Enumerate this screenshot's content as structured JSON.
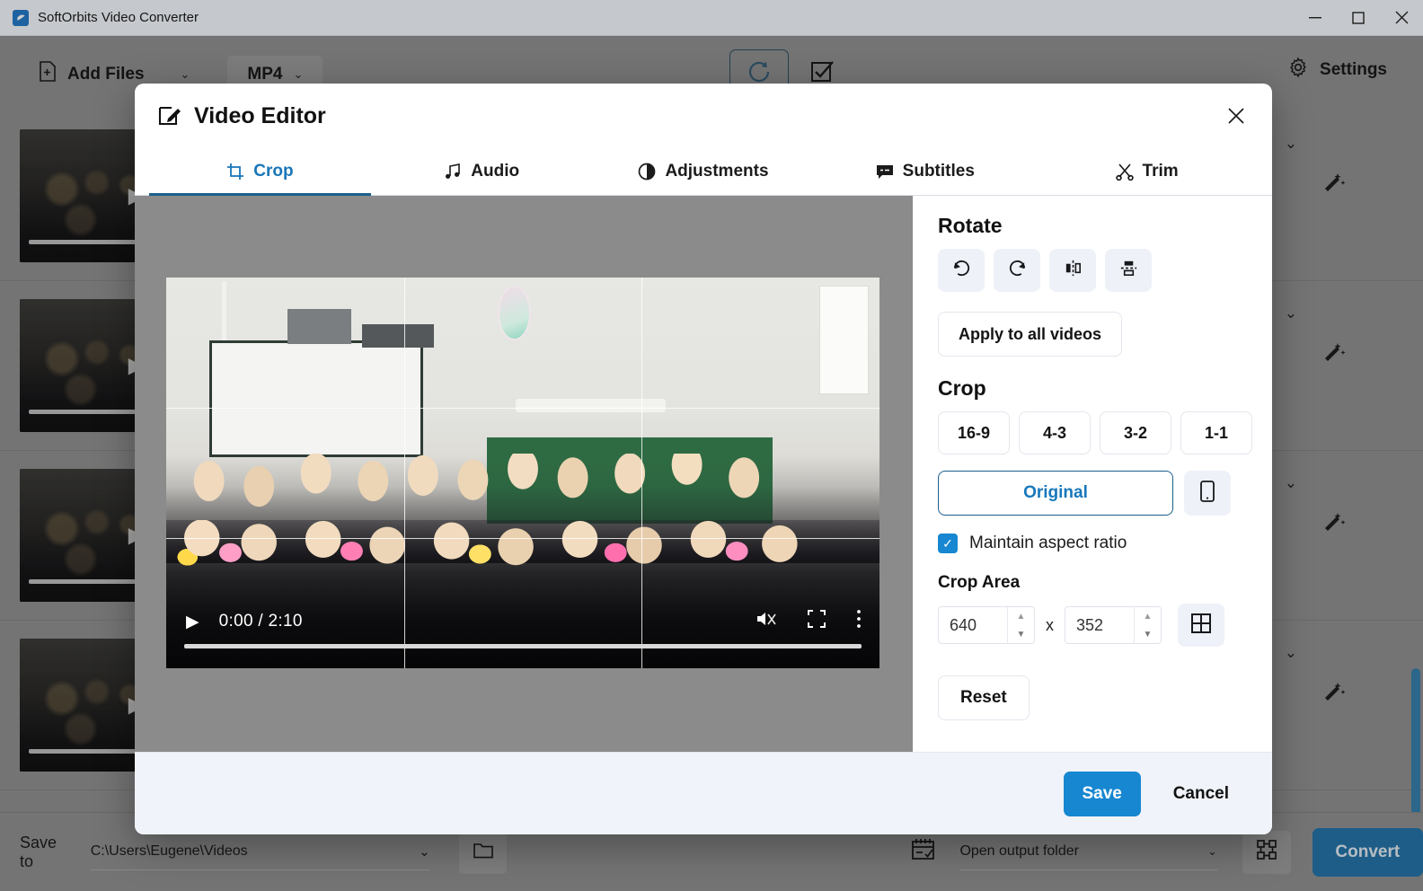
{
  "window": {
    "title": "SoftOrbits Video Converter",
    "app_icon": "app-logo-icon",
    "minimize": "–",
    "maximize": "▫",
    "close": "✕"
  },
  "toolbar": {
    "add_files_label": "Add Files",
    "add_files_chevron": "⌄",
    "format_label": "MP4",
    "format_chevron": "⌄",
    "refresh_icon": "refresh-icon",
    "select_all_icon": "checkbox-checked-icon",
    "settings_label": "Settings",
    "settings_icon": "gear-icon"
  },
  "file_list": {
    "rows": [
      {
        "chevron": "⌄",
        "wand": "✨",
        "play": "▶",
        "speaker": "🔊"
      },
      {
        "chevron": "⌄",
        "wand": "✨",
        "play": "▶",
        "speaker": "🔊"
      },
      {
        "chevron": "⌄",
        "wand": "✨",
        "play": "▶",
        "speaker": "🔊"
      },
      {
        "chevron": "⌄",
        "wand": "✨",
        "play": "▶",
        "speaker": "🔊"
      }
    ]
  },
  "bottom_bar": {
    "save_to_label": "Save to",
    "path_value": "C:\\Users\\Eugene\\Videos",
    "path_chevron": "⌄",
    "folder_icon": "folder-icon",
    "post_action_icon": "checklist-icon",
    "open_output_value": "Open output folder",
    "open_output_chevron": "⌄",
    "merge_icon": "merge-icon",
    "convert_label": "Convert"
  },
  "dialog": {
    "title": "Video Editor",
    "title_icon": "edit-pencil-icon",
    "close_icon": "✕",
    "tabs": [
      {
        "label": "Crop",
        "icon": "crop-icon",
        "active": true
      },
      {
        "label": "Audio",
        "icon": "music-note-icon",
        "active": false
      },
      {
        "label": "Adjustments",
        "icon": "contrast-icon",
        "active": false
      },
      {
        "label": "Subtitles",
        "icon": "subtitles-icon",
        "active": false
      },
      {
        "label": "Trim",
        "icon": "scissors-icon",
        "active": false
      }
    ],
    "player": {
      "play_icon": "play-icon",
      "time": "0:00 / 2:10",
      "mute_icon": "muted-volume-icon",
      "fullscreen_icon": "fullscreen-icon",
      "more_icon": "more-vertical-icon"
    },
    "panel": {
      "rotate_title": "Rotate",
      "rotate_buttons": [
        {
          "name": "rotate-left-icon"
        },
        {
          "name": "rotate-right-icon"
        },
        {
          "name": "flip-horizontal-icon"
        },
        {
          "name": "flip-vertical-icon"
        }
      ],
      "apply_all_label": "Apply to all videos",
      "crop_title": "Crop",
      "ratios": [
        "16-9",
        "4-3",
        "3-2",
        "1-1"
      ],
      "original_label": "Original",
      "portrait_icon": "phone-portrait-icon",
      "aspect_checkbox_checked": true,
      "aspect_check_mark": "✓",
      "aspect_label": "Maintain aspect ratio",
      "crop_area_title": "Crop Area",
      "crop_width": "640",
      "crop_height": "352",
      "crop_separator": "x",
      "spin_up": "▲",
      "spin_down": "▼",
      "grid_toggle_icon": "grid-icon",
      "reset_label": "Reset"
    },
    "footer": {
      "save_label": "Save",
      "cancel_label": "Cancel"
    }
  },
  "colors": {
    "accent_blue": "#1787d1",
    "tab_active": "#1976b8",
    "tab_underline": "#1c5f8c",
    "convert_blue": "#1b6ea5",
    "window_gray": "#8b8b8b",
    "footer_gray": "#f0f3f9",
    "scrollbar_blue": "#2f7aa8"
  }
}
